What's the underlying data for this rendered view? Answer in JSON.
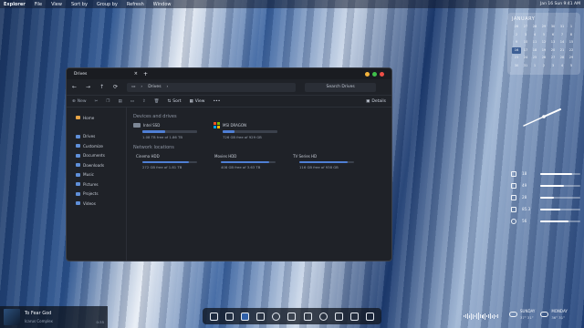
{
  "menubar": {
    "items": [
      "Explorer",
      "File",
      "View",
      "Sort by",
      "Group by",
      "Refresh",
      "Window"
    ],
    "clock": "Jan 16 Sun 9:41 AM"
  },
  "window": {
    "tab_title": "Drives",
    "address": "Drives",
    "search_placeholder": "Search Drives",
    "toolbar": {
      "new": "New",
      "sort": "Sort",
      "view": "View",
      "more": "•••",
      "details": "Details"
    },
    "sidebar": {
      "home": "Home",
      "items": [
        "Drives",
        "Customize",
        "Documents",
        "Downloads",
        "Music",
        "Pictures",
        "Projects",
        "Videos"
      ]
    },
    "devices_heading": "Devices and drives",
    "drives": [
      {
        "name": "Intel SSD",
        "free": "1.08 TB free of 1.86 TB",
        "used_fraction": 0.42
      },
      {
        "name": "MSI DRAGON",
        "free": "726 GB free of 929 GB",
        "used_fraction": 0.22
      }
    ],
    "network_heading": "Network locations",
    "network": [
      {
        "name": "Cinema HDD",
        "free": "272 GB free of 1.81 TB",
        "used_fraction": 0.85
      },
      {
        "name": "Movies HDD",
        "free": "408 GB free of 3.63 TB",
        "used_fraction": 0.89
      },
      {
        "name": "TV Series HD",
        "free": "116 GB free of 938 GB",
        "used_fraction": 0.88
      }
    ]
  },
  "calendar": {
    "month": "JANUARY",
    "days": [
      "26",
      "27",
      "28",
      "29",
      "30",
      "31",
      "1",
      "2",
      "3",
      "4",
      "5",
      "6",
      "7",
      "8",
      "9",
      "10",
      "11",
      "12",
      "13",
      "14",
      "15",
      "16",
      "17",
      "18",
      "19",
      "20",
      "21",
      "22",
      "23",
      "24",
      "25",
      "26",
      "27",
      "28",
      "29",
      "30",
      "31",
      "1",
      "2",
      "3",
      "4",
      "5"
    ],
    "today_index": 21
  },
  "stats": [
    {
      "value": "18",
      "level": 0.8
    },
    {
      "value": "49",
      "level": 0.6
    },
    {
      "value": "28",
      "level": 0.35
    },
    {
      "value": "85.3",
      "level": 0.5
    },
    {
      "value": "56",
      "level": 0.7
    }
  ],
  "media": {
    "song": "To Fear God",
    "artist": "Icarus Complex",
    "time": "0:35"
  },
  "weather": [
    {
      "day": "SUNDAY",
      "temp": "37° 31°"
    },
    {
      "day": "MONDAY",
      "temp": "36° 31°"
    }
  ]
}
